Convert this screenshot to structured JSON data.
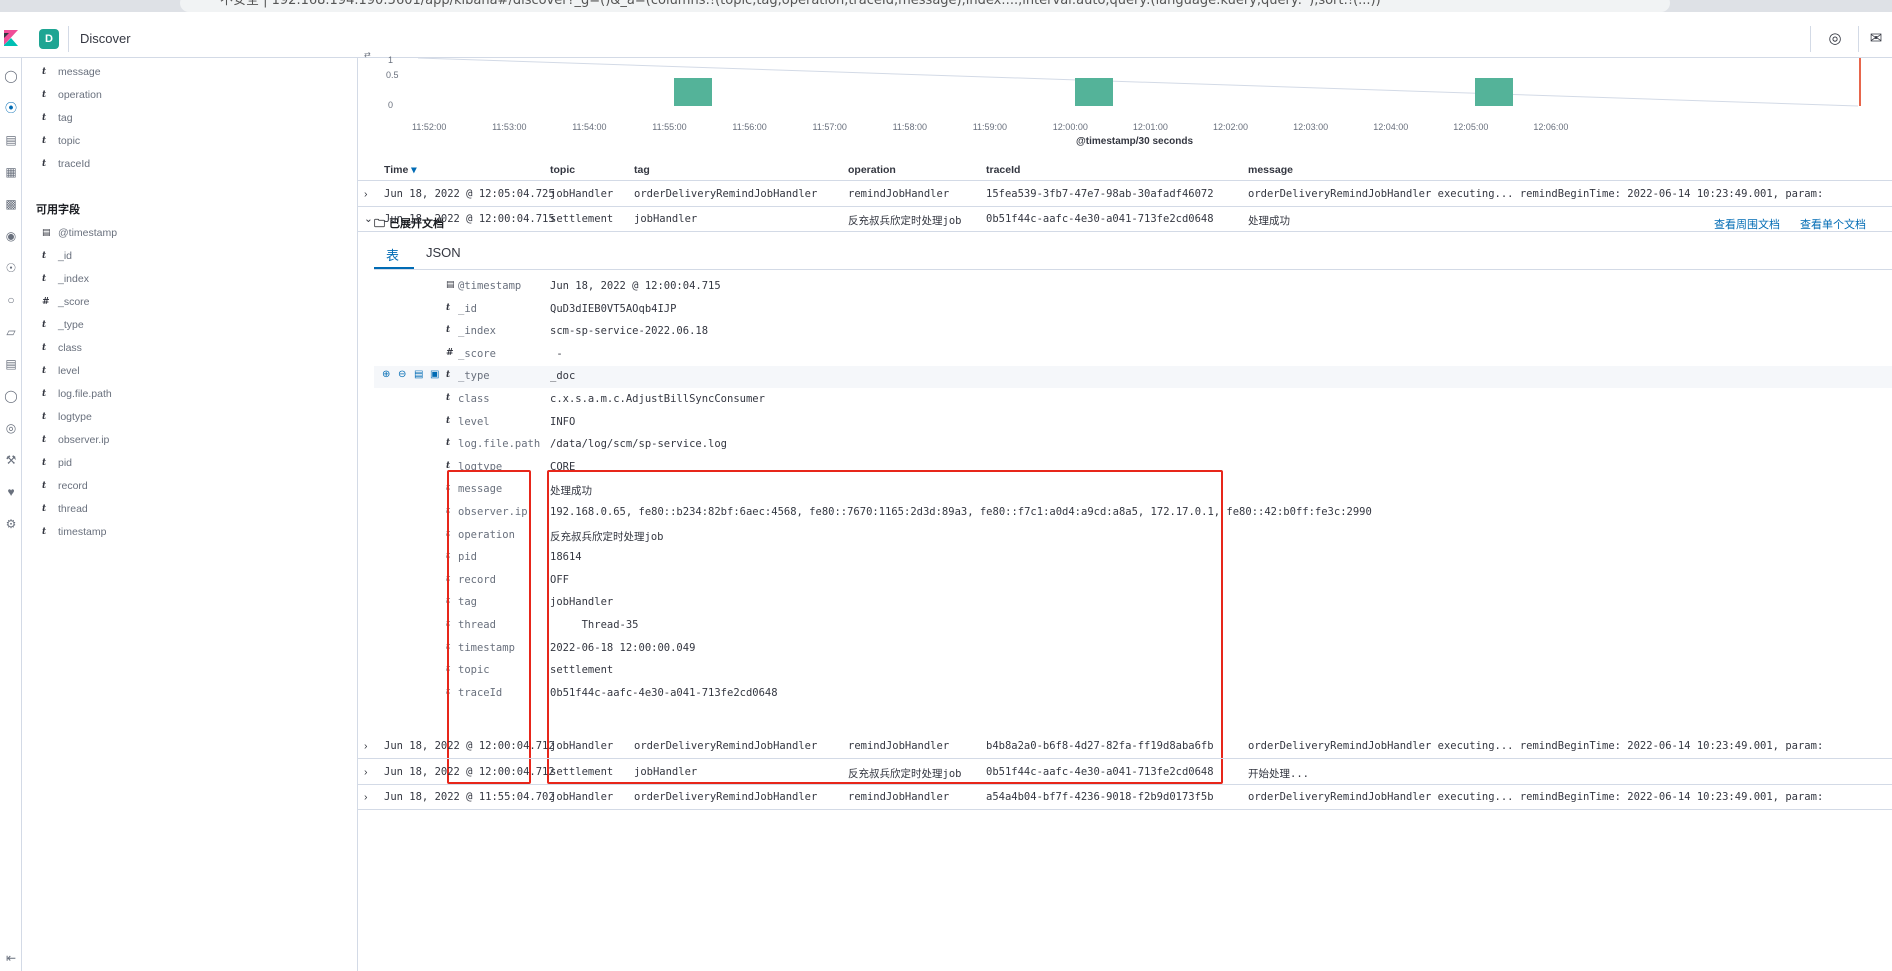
{
  "browser": {
    "url": "不安全 | 192.168.194.190:5601/app/kibana#/discover?_g=()&_a=(columns:!(topic,tag,operation,traceId,message),index:...,interval:auto,query:(language:kuery,query:''),sort:!(...))"
  },
  "header": {
    "space_letter": "D",
    "title": "Discover"
  },
  "sidebar": {
    "selected_fields": [
      "message",
      "operation",
      "tag",
      "topic",
      "traceId"
    ],
    "available_title": "可用字段",
    "available_fields": [
      {
        "type": "clock",
        "name": "@timestamp"
      },
      {
        "type": "t",
        "name": "_id"
      },
      {
        "type": "t",
        "name": "_index"
      },
      {
        "type": "#",
        "name": "_score"
      },
      {
        "type": "t",
        "name": "_type"
      },
      {
        "type": "t",
        "name": "class"
      },
      {
        "type": "t",
        "name": "level"
      },
      {
        "type": "t",
        "name": "log.file.path"
      },
      {
        "type": "t",
        "name": "logtype"
      },
      {
        "type": "t",
        "name": "observer.ip"
      },
      {
        "type": "t",
        "name": "pid"
      },
      {
        "type": "t",
        "name": "record"
      },
      {
        "type": "t",
        "name": "thread"
      },
      {
        "type": "t",
        "name": "timestamp"
      }
    ]
  },
  "chart_data": {
    "type": "bar",
    "ylabels": [
      "1",
      "0.5",
      "0"
    ],
    "ylim": [
      0,
      1
    ],
    "categories": [
      "11:55:00",
      "12:00:00",
      "12:05:00"
    ],
    "values": [
      1,
      1,
      1
    ],
    "xticks": [
      "11:52:00",
      "11:53:00",
      "11:54:00",
      "11:55:00",
      "11:56:00",
      "11:57:00",
      "11:58:00",
      "11:59:00",
      "12:00:00",
      "12:01:00",
      "12:02:00",
      "12:03:00",
      "12:04:00",
      "12:05:00",
      "12:06:00"
    ],
    "xlabel": "@timestamp/30 seconds",
    "color": "#54b399"
  },
  "table": {
    "columns": [
      "Time",
      "topic",
      "tag",
      "operation",
      "traceId",
      "message"
    ],
    "rows_top": [
      {
        "time": "Jun 18, 2022 @ 12:05:04.725",
        "topic": "jobHandler",
        "tag": "orderDeliveryRemindJobHandler",
        "operation": "remindJobHandler",
        "traceId": "15fea539-3fb7-47e7-98ab-30afadf46072",
        "message": "orderDeliveryRemindJobHandler executing... remindBeginTime: 2022-06-14 10:23:49.001, param:"
      },
      {
        "time": "Jun 18, 2022 @ 12:00:04.715",
        "topic": "settlement",
        "tag": "jobHandler",
        "operation": "反充叔兵欣定时处理job",
        "traceId": "0b51f44c-aafc-4e30-a041-713fe2cd0648",
        "message": "处理成功"
      }
    ],
    "rows_bottom": [
      {
        "time": "Jun 18, 2022 @ 12:00:04.712",
        "topic": "jobHandler",
        "tag": "orderDeliveryRemindJobHandler",
        "operation": "remindJobHandler",
        "traceId": "b4b8a2a0-b6f8-4d27-82fa-ff19d8aba6fb",
        "message": "orderDeliveryRemindJobHandler executing... remindBeginTime: 2022-06-14 10:23:49.001, param:"
      },
      {
        "time": "Jun 18, 2022 @ 12:00:04.712",
        "topic": "settlement",
        "tag": "jobHandler",
        "operation": "反充叔兵欣定时处理job",
        "traceId": "0b51f44c-aafc-4e30-a041-713fe2cd0648",
        "message": "开始处理..."
      },
      {
        "time": "Jun 18, 2022 @ 11:55:04.702",
        "topic": "jobHandler",
        "tag": "orderDeliveryRemindJobHandler",
        "operation": "remindJobHandler",
        "traceId": "a54a4b04-bf7f-4236-9018-f2b9d0173f5b",
        "message": "orderDeliveryRemindJobHandler executing... remindBeginTime: 2022-06-14 10:23:49.001, param:"
      }
    ]
  },
  "doc": {
    "title": "已展开文档",
    "link_surrounding": "查看周围文档",
    "link_single": "查看单个文档",
    "tab_table": "表",
    "tab_json": "JSON",
    "fields": [
      {
        "type": "clock",
        "name": "@timestamp",
        "value": "Jun 18, 2022 @ 12:00:04.715"
      },
      {
        "type": "t",
        "name": "_id",
        "value": "QuD3dIEB0VT5AOqb4IJP"
      },
      {
        "type": "t",
        "name": "_index",
        "value": "scm-sp-service-2022.06.18"
      },
      {
        "type": "#",
        "name": "_score",
        "value": " -"
      },
      {
        "type": "t",
        "name": "_type",
        "value": "_doc"
      },
      {
        "type": "t",
        "name": "class",
        "value": "c.x.s.a.m.c.AdjustBillSyncConsumer"
      },
      {
        "type": "t",
        "name": "level",
        "value": "INFO"
      },
      {
        "type": "t",
        "name": "log.file.path",
        "value": "/data/log/scm/sp-service.log"
      },
      {
        "type": "t",
        "name": "logtype",
        "value": "CORE"
      },
      {
        "type": "t",
        "name": "message",
        "value": "处理成功"
      },
      {
        "type": "t",
        "name": "observer.ip",
        "value": "192.168.0.65, fe80::b234:82bf:6aec:4568, fe80::7670:1165:2d3d:89a3, fe80::f7c1:a0d4:a9cd:a8a5, 172.17.0.1, fe80::42:b0ff:fe3c:2990"
      },
      {
        "type": "t",
        "name": "operation",
        "value": "反充叔兵欣定时处理job"
      },
      {
        "type": "t",
        "name": "pid",
        "value": "18614"
      },
      {
        "type": "t",
        "name": "record",
        "value": "OFF"
      },
      {
        "type": "t",
        "name": "tag",
        "value": "jobHandler"
      },
      {
        "type": "t",
        "name": "thread",
        "value": "     Thread-35"
      },
      {
        "type": "t",
        "name": "timestamp",
        "value": "2022-06-18 12:00:00.049"
      },
      {
        "type": "t",
        "name": "topic",
        "value": "settlement"
      },
      {
        "type": "t",
        "name": "traceId",
        "value": "0b51f44c-aafc-4e30-a041-713fe2cd0648"
      }
    ]
  }
}
